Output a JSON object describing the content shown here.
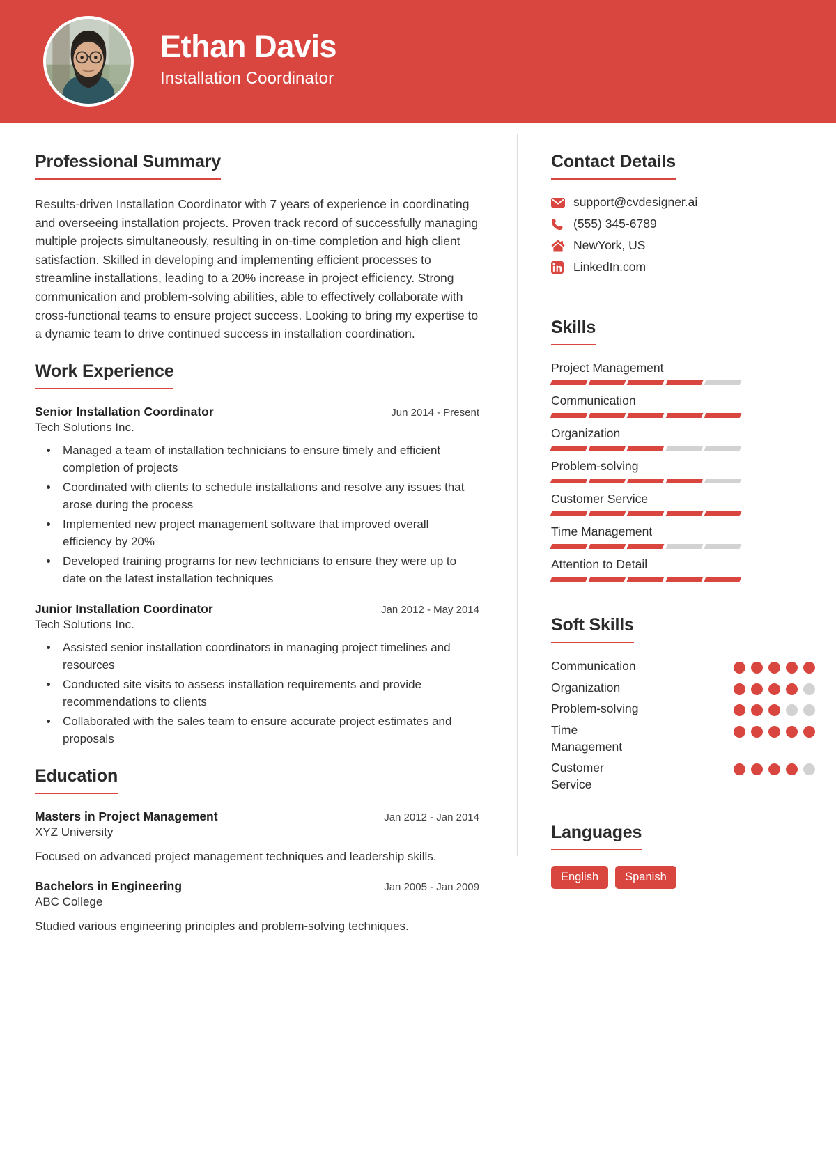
{
  "theme": {
    "accent": "#d9453f",
    "muted": "#d2d2d2",
    "text": "#2b2b2b"
  },
  "header": {
    "name": "Ethan Davis",
    "job_title": "Installation Coordinator",
    "avatar_name": "profile-photo"
  },
  "summary": {
    "heading": "Professional Summary",
    "text": "Results-driven Installation Coordinator with 7 years of experience in coordinating and overseeing installation projects. Proven track record of successfully managing multiple projects simultaneously, resulting in on-time completion and high client satisfaction. Skilled in developing and implementing efficient processes to streamline installations, leading to a 20% increase in project efficiency. Strong communication and problem-solving abilities, able to effectively collaborate with cross-functional teams to ensure project success. Looking to bring my expertise to a dynamic team to drive continued success in installation coordination."
  },
  "experience": {
    "heading": "Work Experience",
    "entries": [
      {
        "title": "Senior Installation Coordinator",
        "org": "Tech Solutions Inc.",
        "date": "Jun 2014 - Present",
        "bullets": [
          "Managed a team of installation technicians to ensure timely and efficient completion of projects",
          "Coordinated with clients to schedule installations and resolve any issues that arose during the process",
          "Implemented new project management software that improved overall efficiency by 20%",
          "Developed training programs for new technicians to ensure they were up to date on the latest installation techniques"
        ]
      },
      {
        "title": "Junior Installation Coordinator",
        "org": "Tech Solutions Inc.",
        "date": "Jan 2012 - May 2014",
        "bullets": [
          "Assisted senior installation coordinators in managing project timelines and resources",
          "Conducted site visits to assess installation requirements and provide recommendations to clients",
          "Collaborated with the sales team to ensure accurate project estimates and proposals"
        ]
      }
    ]
  },
  "education": {
    "heading": "Education",
    "entries": [
      {
        "title": "Masters in Project Management",
        "org": "XYZ University",
        "date": "Jan 2012 - Jan 2014",
        "description": "Focused on advanced project management techniques and leadership skills."
      },
      {
        "title": "Bachelors in Engineering",
        "org": "ABC College",
        "date": "Jan 2005 - Jan 2009",
        "description": "Studied various engineering principles and problem-solving techniques."
      }
    ]
  },
  "contact": {
    "heading": "Contact Details",
    "items": [
      {
        "icon": "envelope-icon",
        "value": "support@cvdesigner.ai"
      },
      {
        "icon": "phone-icon",
        "value": "(555) 345-6789"
      },
      {
        "icon": "home-icon",
        "value": "NewYork, US"
      },
      {
        "icon": "linkedin-icon",
        "value": "LinkedIn.com"
      }
    ]
  },
  "skills": {
    "heading": "Skills",
    "segments_total": 5,
    "items": [
      {
        "name": "Project Management",
        "filled": 4
      },
      {
        "name": "Communication",
        "filled": 5
      },
      {
        "name": "Organization",
        "filled": 3
      },
      {
        "name": "Problem-solving",
        "filled": 4
      },
      {
        "name": "Customer Service",
        "filled": 5
      },
      {
        "name": "Time Management",
        "filled": 3
      },
      {
        "name": "Attention to Detail",
        "filled": 5
      }
    ]
  },
  "soft_skills": {
    "heading": "Soft Skills",
    "dots_total": 5,
    "items": [
      {
        "name": "Communication",
        "filled": 5
      },
      {
        "name": "Organization",
        "filled": 4
      },
      {
        "name": "Problem-solving",
        "filled": 3
      },
      {
        "name": "Time Management",
        "filled": 5
      },
      {
        "name": "Customer Service",
        "filled": 4
      }
    ]
  },
  "languages": {
    "heading": "Languages",
    "items": [
      "English",
      "Spanish"
    ]
  }
}
